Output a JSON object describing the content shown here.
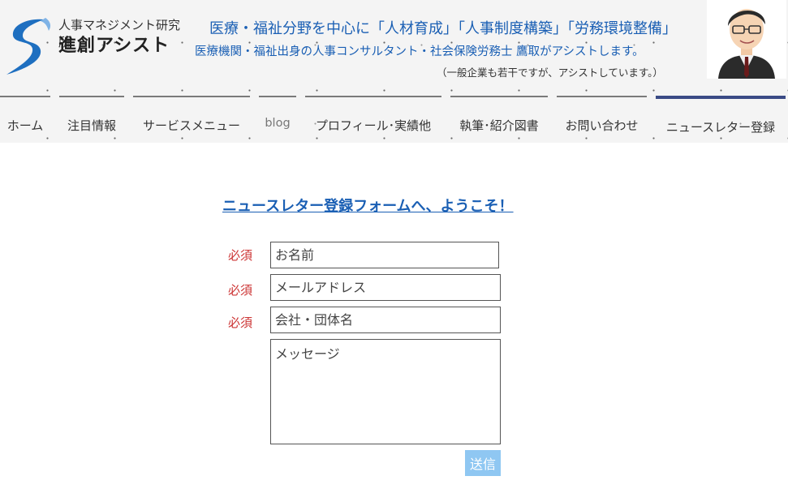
{
  "header": {
    "logo_subtitle": "人事マネジメント研究所",
    "logo_title": "進創アシスト",
    "tagline_main": "医療・福祉分野を中心に「人材育成」「人事制度構築」「労務環境整備」",
    "tagline_sub": "医療機関・福祉出身の人事コンサルタント・社会保険労務士 鷹取がアシストします。",
    "tagline_note": "（一般企業も若干ですが、アシストしています。）",
    "accent_color": "#1a5fb4"
  },
  "nav": {
    "items": [
      {
        "label": "ホーム"
      },
      {
        "label": "注目情報"
      },
      {
        "label": "サービスメニュー"
      },
      {
        "label": "blog"
      },
      {
        "label": "プロフィール･実績他"
      },
      {
        "label": "執筆･紹介図書"
      },
      {
        "label": "お問い合わせ"
      },
      {
        "label": "ニュースレター登録"
      }
    ],
    "active_index": 7
  },
  "form": {
    "title": "ニュースレター登録フォームへ、ようこそ！",
    "required_label": "必須",
    "name_placeholder": "お名前",
    "email_placeholder": "メールアドレス",
    "company_placeholder": "会社・団体名",
    "message_placeholder": "メッセージ",
    "submit_label": "送信"
  }
}
